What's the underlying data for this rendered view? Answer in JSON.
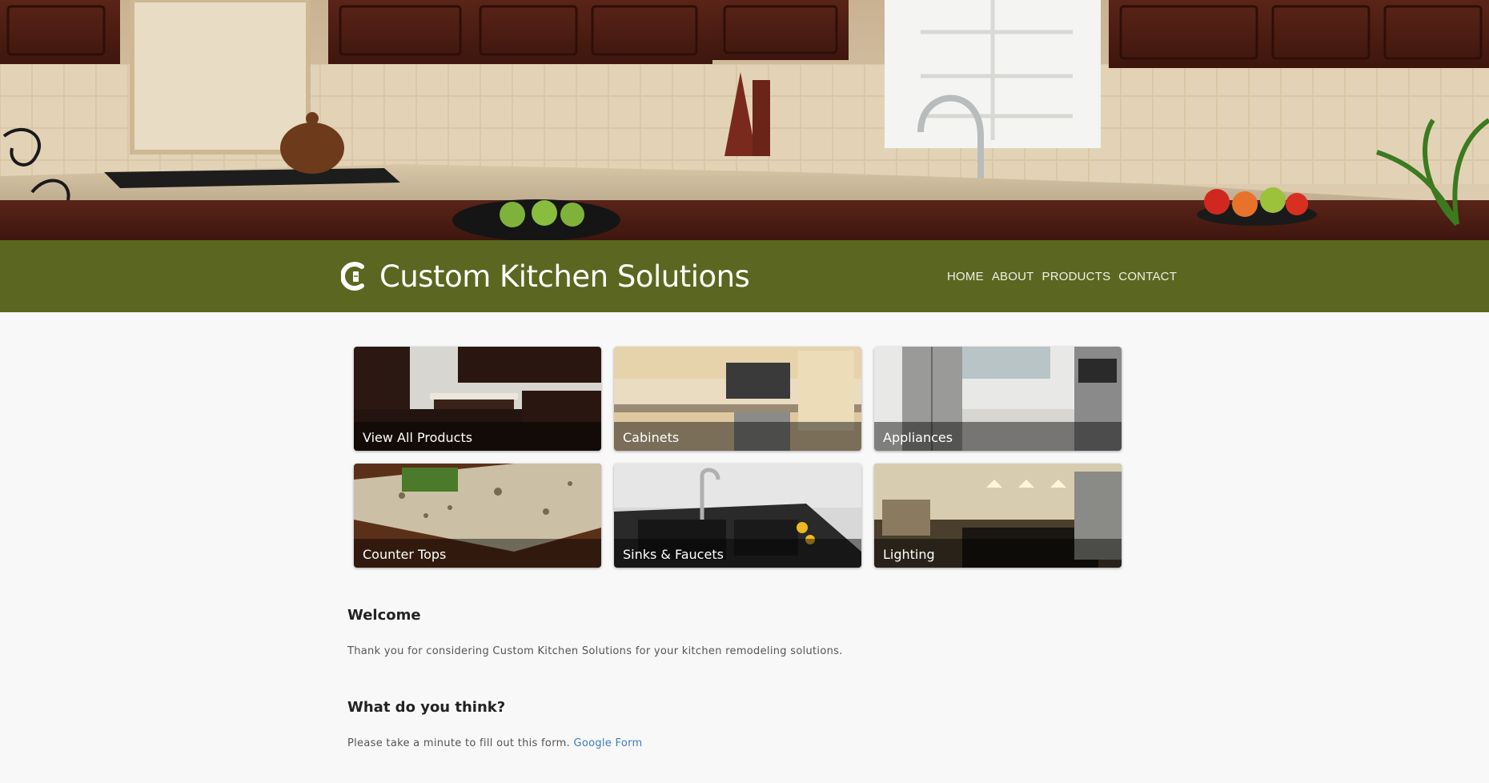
{
  "site": {
    "brand_name": "Custom Kitchen Solutions"
  },
  "nav": {
    "items": [
      "HOME",
      "ABOUT",
      "PRODUCTS",
      "CONTACT"
    ]
  },
  "tiles": [
    {
      "label": "View All Products"
    },
    {
      "label": "Cabinets"
    },
    {
      "label": "Appliances"
    },
    {
      "label": "Counter Tops"
    },
    {
      "label": "Sinks & Faucets"
    },
    {
      "label": "Lighting"
    }
  ],
  "welcome": {
    "title": "Welcome",
    "text": "Thank you for considering Custom Kitchen Solutions for your kitchen remodeling solutions."
  },
  "feedback": {
    "title": "What do you think?",
    "text": "Please take a minute to fill out this form.",
    "link_label": "Google Form"
  },
  "colors": {
    "header_bar": "#5b6720",
    "link": "#3a7cc1",
    "page_background": "#f8f8f8"
  },
  "icons": {
    "brand_logo": "kitchen-logo-icon"
  }
}
